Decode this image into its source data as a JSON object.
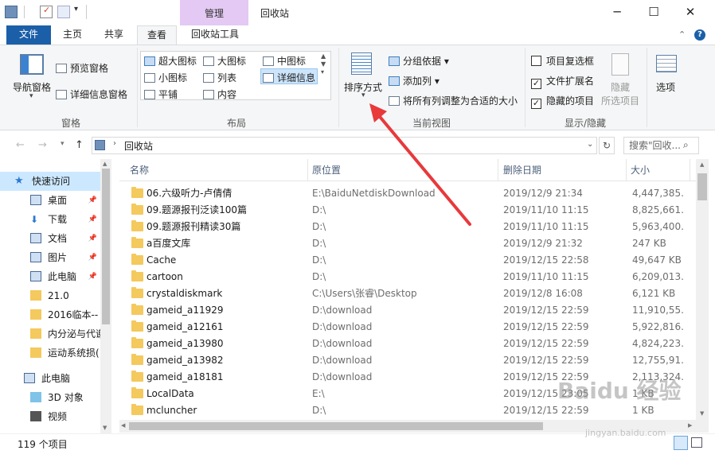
{
  "window": {
    "title": "回收站",
    "manage_tab": "管理"
  },
  "tabs": [
    "文件",
    "主页",
    "共享",
    "查看",
    "回收站工具"
  ],
  "ribbon": {
    "panes": {
      "nav_pane": "导航窗格",
      "preview_pane": "预览窗格",
      "details_pane": "详细信息窗格",
      "label": "窗格"
    },
    "layout": {
      "items": [
        "超大图标",
        "大图标",
        "中图标",
        "小图标",
        "列表",
        "详细信息",
        "平铺",
        "内容"
      ],
      "label": "布局"
    },
    "current_view": {
      "sort_by": "排序方式",
      "group_by": "分组依据",
      "add_columns": "添加列",
      "fit_columns": "将所有列调整为合适的大小",
      "label": "当前视图"
    },
    "show_hide": {
      "item_checkboxes": "项目复选框",
      "file_extensions": "文件扩展名",
      "hidden_items": "隐藏的项目",
      "hide": "隐藏",
      "selected_items": "所选项目",
      "label": "显示/隐藏"
    },
    "options": "选项"
  },
  "address": {
    "path": "回收站",
    "search_placeholder": "搜索\"回收..."
  },
  "nav": [
    {
      "label": "快速访问",
      "icon": "star-icon",
      "pinned": false
    },
    {
      "label": "桌面",
      "icon": "desktop-icon",
      "pinned": true
    },
    {
      "label": "下载",
      "icon": "download-icon",
      "pinned": true
    },
    {
      "label": "文档",
      "icon": "document-icon",
      "pinned": true
    },
    {
      "label": "图片",
      "icon": "picture-icon",
      "pinned": true
    },
    {
      "label": "此电脑",
      "icon": "computer-icon",
      "pinned": true
    },
    {
      "label": "21.0",
      "icon": "folder-icon",
      "pinned": false
    },
    {
      "label": "2016临本--",
      "icon": "folder-icon",
      "pinned": false
    },
    {
      "label": "内分泌与代谢",
      "icon": "folder-icon",
      "pinned": false
    },
    {
      "label": "运动系统损(",
      "icon": "folder-icon",
      "pinned": false
    },
    {
      "label": "此电脑",
      "icon": "computer-icon",
      "pinned": false
    },
    {
      "label": "3D 对象",
      "icon": "cube-icon",
      "pinned": false
    },
    {
      "label": "视频",
      "icon": "video-icon",
      "pinned": false
    }
  ],
  "columns": [
    "名称",
    "原位置",
    "删除日期",
    "大小"
  ],
  "files": [
    {
      "name": "06.六级听力-卢倩倩",
      "location": "E:\\BaiduNetdiskDownload",
      "date": "2019/12/9 21:34",
      "size": "4,447,385..."
    },
    {
      "name": "09.题源报刊泛读100篇",
      "location": "D:\\",
      "date": "2019/11/10 11:15",
      "size": "8,825,661..."
    },
    {
      "name": "09.题源报刊精读30篇",
      "location": "D:\\",
      "date": "2019/11/10 11:15",
      "size": "5,963,400..."
    },
    {
      "name": "a百度文库",
      "location": "D:\\",
      "date": "2019/12/9 21:32",
      "size": "247 KB"
    },
    {
      "name": "Cache",
      "location": "D:\\",
      "date": "2019/12/15 22:58",
      "size": "49,647 KB"
    },
    {
      "name": "cartoon",
      "location": "D:\\",
      "date": "2019/11/10 11:15",
      "size": "6,209,013..."
    },
    {
      "name": "crystaldiskmark",
      "location": "C:\\Users\\张睿\\Desktop",
      "date": "2019/12/8 16:08",
      "size": "6,121 KB"
    },
    {
      "name": "gameid_a11929",
      "location": "D:\\download",
      "date": "2019/12/15 22:59",
      "size": "11,910,55..."
    },
    {
      "name": "gameid_a12161",
      "location": "D:\\download",
      "date": "2019/12/15 22:59",
      "size": "5,922,816..."
    },
    {
      "name": "gameid_a13980",
      "location": "D:\\download",
      "date": "2019/12/15 22:59",
      "size": "4,824,223..."
    },
    {
      "name": "gameid_a13982",
      "location": "D:\\download",
      "date": "2019/12/15 22:59",
      "size": "12,755,91..."
    },
    {
      "name": "gameid_a18181",
      "location": "D:\\download",
      "date": "2019/12/15 22:59",
      "size": "2,113,324..."
    },
    {
      "name": "LocalData",
      "location": "E:\\",
      "date": "2019/12/15 23:05",
      "size": "1 KB"
    },
    {
      "name": "mcluncher",
      "location": "D:\\",
      "date": "2019/12/15 22:59",
      "size": "1 KB"
    }
  ],
  "status": {
    "count": "119 个项目"
  },
  "watermark": {
    "brand": "Baidu 经验",
    "url": "jingyan.baidu.com"
  },
  "colors": {
    "file_tab": "#1b5fa8",
    "manage_tab": "#e3c9f3",
    "arrow": "#e8393b",
    "folder": "#f4c95d"
  }
}
